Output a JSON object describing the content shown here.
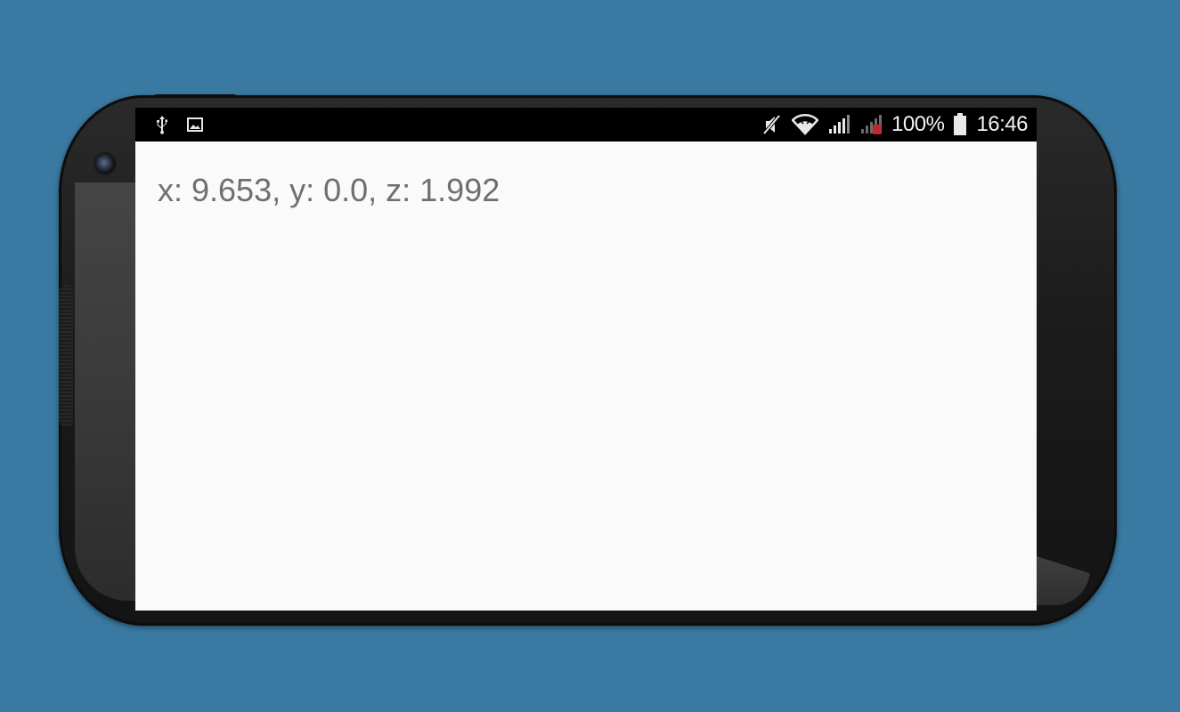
{
  "status_bar": {
    "left_icons": [
      "usb-icon",
      "image-icon"
    ],
    "right_icons": [
      "mute-icon",
      "wifi-icon",
      "signal-icon",
      "signal-no-sim-icon",
      "battery-icon"
    ],
    "battery_percent": "100%",
    "clock": "16:46"
  },
  "sensor_readout": {
    "text": "x: 9.653, y: 0.0, z: 1.992"
  },
  "colors": {
    "background": "#3a79a1",
    "screen_bg": "#fafafa",
    "status_bar_bg": "#000000",
    "readout_text": "#6f6f6f",
    "signal_alert": "#c0272d"
  }
}
